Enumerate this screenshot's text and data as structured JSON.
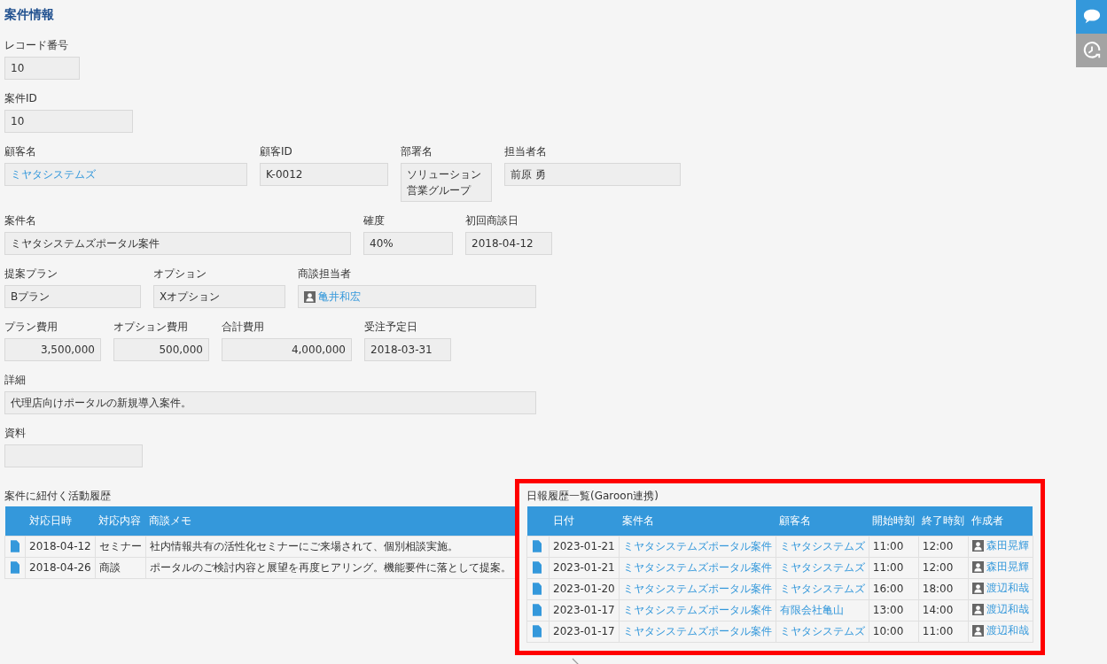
{
  "title": "案件情報",
  "form_rows": [
    [
      {
        "label": "レコード番号",
        "value": "10",
        "kind": "text"
      }
    ],
    [
      {
        "label": "案件ID",
        "value": "10",
        "kind": "text"
      }
    ],
    [
      {
        "label": "顧客名",
        "value": "ミヤタシステムズ",
        "kind": "link"
      },
      {
        "label": "顧客ID",
        "value": "K-0012",
        "kind": "text"
      },
      {
        "label": "部署名",
        "value": "ソリューション営業グループ",
        "kind": "text"
      },
      {
        "label": "担当者名",
        "value": "前原 勇",
        "kind": "text"
      }
    ],
    [
      {
        "label": "案件名",
        "value": "ミヤタシステムズポータル案件",
        "kind": "text"
      },
      {
        "label": "確度",
        "value": "40%",
        "kind": "text"
      },
      {
        "label": "初回商談日",
        "value": "2018-04-12",
        "kind": "text"
      }
    ],
    [
      {
        "label": "提案プラン",
        "value": "Bプラン",
        "kind": "text"
      },
      {
        "label": "オプション",
        "value": "Xオプション",
        "kind": "text"
      },
      {
        "label": "商談担当者",
        "value": "亀井和宏",
        "kind": "user"
      }
    ],
    [
      {
        "label": "プラン費用",
        "value": "3,500,000",
        "kind": "number"
      },
      {
        "label": "オプション費用",
        "value": "500,000",
        "kind": "number"
      },
      {
        "label": "合計費用",
        "value": "4,000,000",
        "kind": "number"
      },
      {
        "label": "受注予定日",
        "value": "2018-03-31",
        "kind": "text"
      }
    ],
    [
      {
        "label": "詳細",
        "value": "代理店向けポータルの新規導入案件。",
        "kind": "text"
      }
    ],
    [
      {
        "label": "資料",
        "kind": "file"
      }
    ]
  ],
  "activity_history": {
    "title": "案件に紐付く活動履歴",
    "columns": [
      "対応日時",
      "対応内容",
      "商談メモ"
    ],
    "rows": [
      {
        "date": "2018-04-12",
        "type": "セミナー",
        "memo": "社内情報共有の活性化セミナーにご来場されて、個別相談実施。"
      },
      {
        "date": "2018-04-26",
        "type": "商談",
        "memo": "ポータルのご検討内容と展望を再度ヒアリング。機能要件に落として提案。"
      }
    ]
  },
  "daily_reports": {
    "title": "日報履歴一覧(Garoon連携)",
    "columns": [
      "日付",
      "案件名",
      "顧客名",
      "開始時刻",
      "終了時刻",
      "作成者"
    ],
    "rows": [
      {
        "date": "2023-01-21",
        "case": "ミヤタシステムズポータル案件",
        "customer": "ミヤタシステムズ",
        "start": "11:00",
        "end": "12:00",
        "author": "森田晃輝"
      },
      {
        "date": "2023-01-21",
        "case": "ミヤタシステムズポータル案件",
        "customer": "ミヤタシステムズ",
        "start": "11:00",
        "end": "12:00",
        "author": "森田晃輝"
      },
      {
        "date": "2023-01-20",
        "case": "ミヤタシステムズポータル案件",
        "customer": "ミヤタシステムズ",
        "start": "16:00",
        "end": "18:00",
        "author": "渡辺和哉"
      },
      {
        "date": "2023-01-17",
        "case": "ミヤタシステムズポータル案件",
        "customer": "有限会社亀山",
        "start": "13:00",
        "end": "14:00",
        "author": "渡辺和哉"
      },
      {
        "date": "2023-01-17",
        "case": "ミヤタシステムズポータル案件",
        "customer": "ミヤタシステムズ",
        "start": "10:00",
        "end": "11:00",
        "author": "渡辺和哉"
      }
    ]
  }
}
